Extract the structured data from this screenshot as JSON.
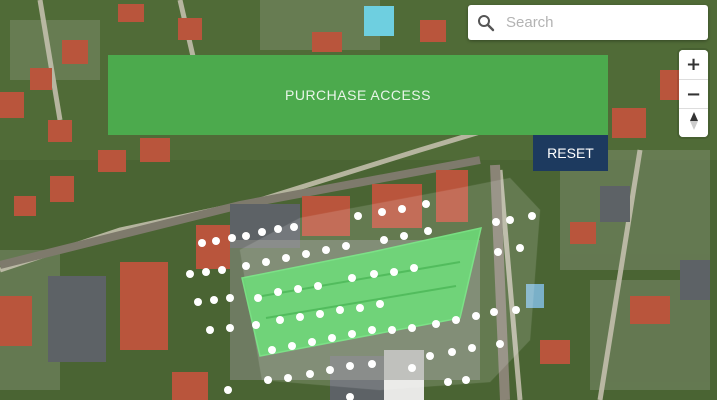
{
  "search": {
    "placeholder": "Search",
    "icon": "search-icon"
  },
  "controls": {
    "zoom_in": "+",
    "zoom_out": "−",
    "reset_bearing_icon": "compass-icon"
  },
  "buttons": {
    "purchase_label": "PURCHASE ACCESS",
    "reset_label": "RESET"
  },
  "colors": {
    "purchase_bg": "#4caa4d",
    "reset_bg": "#1d3a5f",
    "selected_area": "#6de07a"
  }
}
